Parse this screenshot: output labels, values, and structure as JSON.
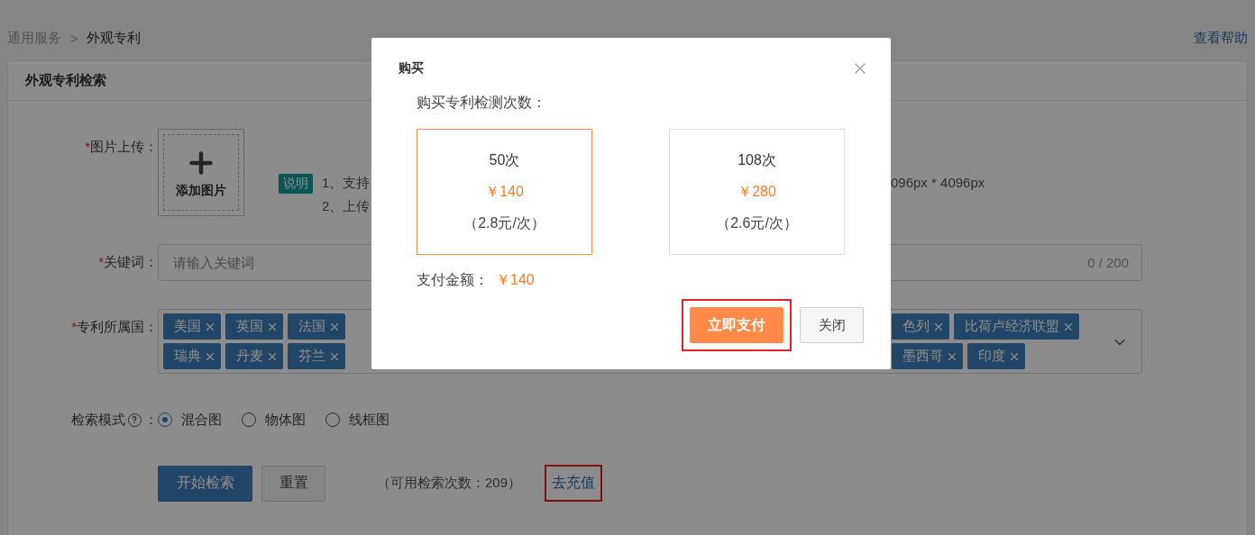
{
  "breadcrumb": {
    "items": [
      {
        "label": "通用服务",
        "current": false
      },
      {
        "label": "外观专利",
        "current": true
      }
    ],
    "separator": ">"
  },
  "help_link": "查看帮助",
  "panel_title": "外观专利检索",
  "upload": {
    "marker": "*",
    "label": "图片上传：",
    "button": "添加图片"
  },
  "note": {
    "badge": "说明",
    "lines": [
      "1、支持",
      "2、上传"
    ],
    "line_right": "096px * 4096px"
  },
  "keyword": {
    "marker": "*",
    "label": "关键词：",
    "placeholder": "请输入关键词",
    "counter": "0 / 200"
  },
  "country": {
    "marker": "*",
    "label": "专利所属国：",
    "rows": [
      {
        "left": [
          "美国",
          "英国",
          "法国"
        ],
        "right": [
          "色列",
          "比荷卢经济联盟"
        ]
      },
      {
        "left": [
          "瑞典",
          "丹麦",
          "芬兰"
        ],
        "right": [
          "墨西哥",
          "印度"
        ]
      }
    ]
  },
  "mode": {
    "label": "检索模式",
    "colon": "：",
    "options": [
      {
        "label": "混合图",
        "selected": true
      },
      {
        "label": "物体图",
        "selected": false
      },
      {
        "label": "线框图",
        "selected": false
      }
    ]
  },
  "actions": {
    "search": "开始检索",
    "reset": "重置",
    "remaining": "（可用检索次数：209）",
    "recharge": "去充值"
  },
  "dialog": {
    "title": "购买",
    "subtitle": "购买专利检测次数：",
    "packages": [
      {
        "count": "50次",
        "price": "￥140",
        "unit": "（2.8元/次）",
        "selected": true
      },
      {
        "count": "108次",
        "price": "￥280",
        "unit": "（2.6元/次）",
        "selected": false
      }
    ],
    "amount_label": "支付金额：",
    "amount": "￥140",
    "pay": "立即支付",
    "close": "关闭"
  }
}
